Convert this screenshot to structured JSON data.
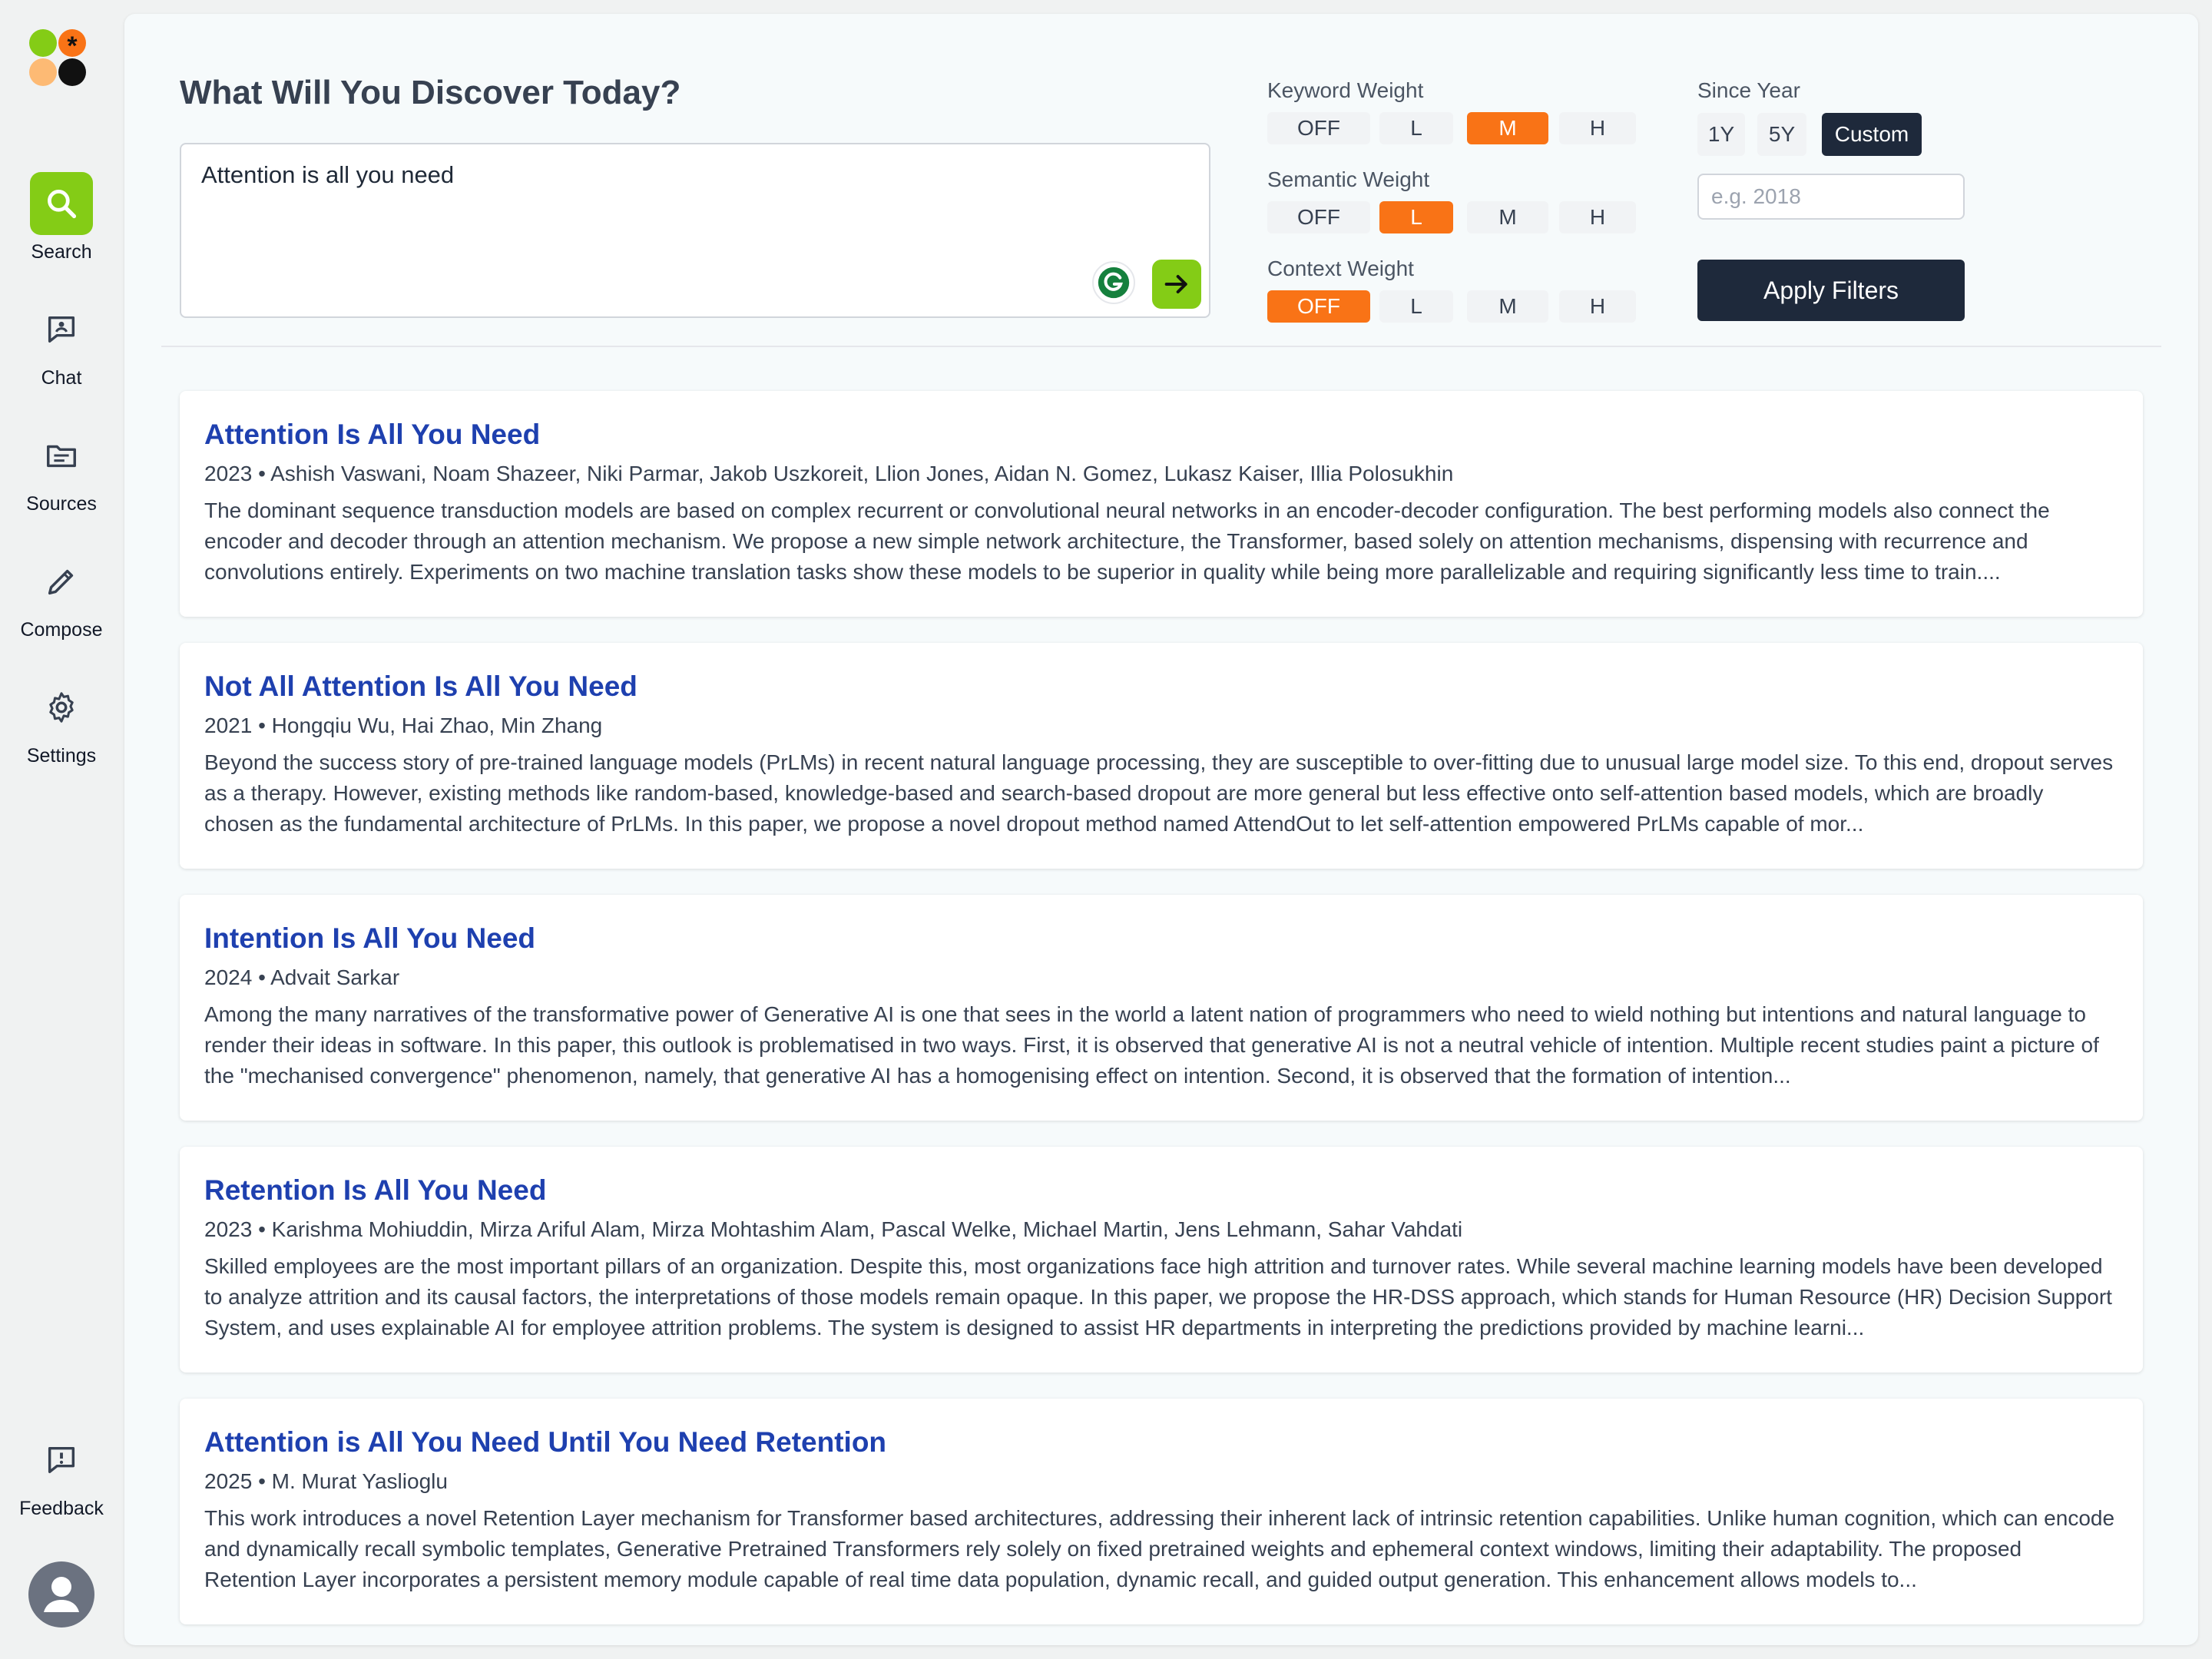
{
  "sidebar": {
    "logo_colors": [
      "#84cc16",
      "#f97316",
      "#fdba74",
      "#111111"
    ],
    "items": [
      {
        "label": "Search",
        "icon": "search-icon",
        "active": true
      },
      {
        "label": "Chat",
        "icon": "chat-icon"
      },
      {
        "label": "Sources",
        "icon": "folder-icon"
      },
      {
        "label": "Compose",
        "icon": "pencil-icon"
      },
      {
        "label": "Settings",
        "icon": "gear-icon"
      }
    ],
    "feedback": {
      "label": "Feedback",
      "icon": "feedback-icon"
    },
    "avatar_icon": "user-avatar-icon"
  },
  "header": {
    "title": "What Will You Discover Today?",
    "query": "Attention is all you need"
  },
  "weights": {
    "options": [
      "OFF",
      "L",
      "M",
      "H"
    ],
    "keyword": {
      "label": "Keyword Weight",
      "selected": "M"
    },
    "semantic": {
      "label": "Semantic Weight",
      "selected": "L"
    },
    "context": {
      "label": "Context Weight",
      "selected": "OFF"
    }
  },
  "since_year": {
    "label": "Since Year",
    "options": [
      "1Y",
      "5Y",
      "Custom"
    ],
    "selected": "Custom",
    "placeholder": "e.g. 2018",
    "apply_label": "Apply Filters"
  },
  "colors": {
    "accent_green": "#84cc16",
    "accent_orange": "#f97316",
    "dark": "#1e293b",
    "link": "#1e40af"
  },
  "results": [
    {
      "title": "Attention Is All You Need",
      "meta": "2023 • Ashish Vaswani, Noam Shazeer, Niki Parmar, Jakob Uszkoreit, Llion Jones, Aidan N. Gomez, Lukasz Kaiser, Illia Polosukhin",
      "abstract": "The dominant sequence transduction models are based on complex recurrent or convolutional neural networks in an encoder-decoder configuration. The best performing models also connect the encoder and decoder through an attention mechanism. We propose a new simple network architecture, the Transformer, based solely on attention mechanisms, dispensing with recurrence and convolutions entirely. Experiments on two machine translation tasks show these models to be superior in quality while being more parallelizable and requiring significantly less time to train...."
    },
    {
      "title": "Not All Attention Is All You Need",
      "meta": "2021 • Hongqiu Wu, Hai Zhao, Min Zhang",
      "abstract": "Beyond the success story of pre-trained language models (PrLMs) in recent natural language processing, they are susceptible to over-fitting due to unusual large model size. To this end, dropout serves as a therapy. However, existing methods like random-based, knowledge-based and search-based dropout are more general but less effective onto self-attention based models, which are broadly chosen as the fundamental architecture of PrLMs. In this paper, we propose a novel dropout method named AttendOut to let self-attention empowered PrLMs capable of mor..."
    },
    {
      "title": "Intention Is All You Need",
      "meta": "2024 • Advait Sarkar",
      "abstract": "Among the many narratives of the transformative power of Generative AI is one that sees in the world a latent nation of programmers who need to wield nothing but intentions and natural language to render their ideas in software. In this paper, this outlook is problematised in two ways. First, it is observed that generative AI is not a neutral vehicle of intention. Multiple recent studies paint a picture of the \"mechanised convergence\" phenomenon, namely, that generative AI has a homogenising effect on intention. Second, it is observed that the formation of intention..."
    },
    {
      "title": "Retention Is All You Need",
      "meta": "2023 • Karishma Mohiuddin, Mirza Ariful Alam, Mirza Mohtashim Alam, Pascal Welke, Michael Martin, Jens Lehmann, Sahar Vahdati",
      "abstract": "Skilled employees are the most important pillars of an organization. Despite this, most organizations face high attrition and turnover rates. While several machine learning models have been developed to analyze attrition and its causal factors, the interpretations of those models remain opaque. In this paper, we propose the HR-DSS approach, which stands for Human Resource (HR) Decision Support System, and uses explainable AI for employee attrition problems. The system is designed to assist HR departments in interpreting the predictions provided by machine learni..."
    },
    {
      "title": "Attention is All You Need Until You Need Retention",
      "meta": "2025 • M. Murat Yaslioglu",
      "abstract": "This work introduces a novel Retention Layer mechanism for Transformer based architectures, addressing their inherent lack of intrinsic retention capabilities. Unlike human cognition, which can encode and dynamically recall symbolic templates, Generative Pretrained Transformers rely solely on fixed pretrained weights and ephemeral context windows, limiting their adaptability. The proposed Retention Layer incorporates a persistent memory module capable of real time data population, dynamic recall, and guided output generation. This enhancement allows models to..."
    }
  ]
}
